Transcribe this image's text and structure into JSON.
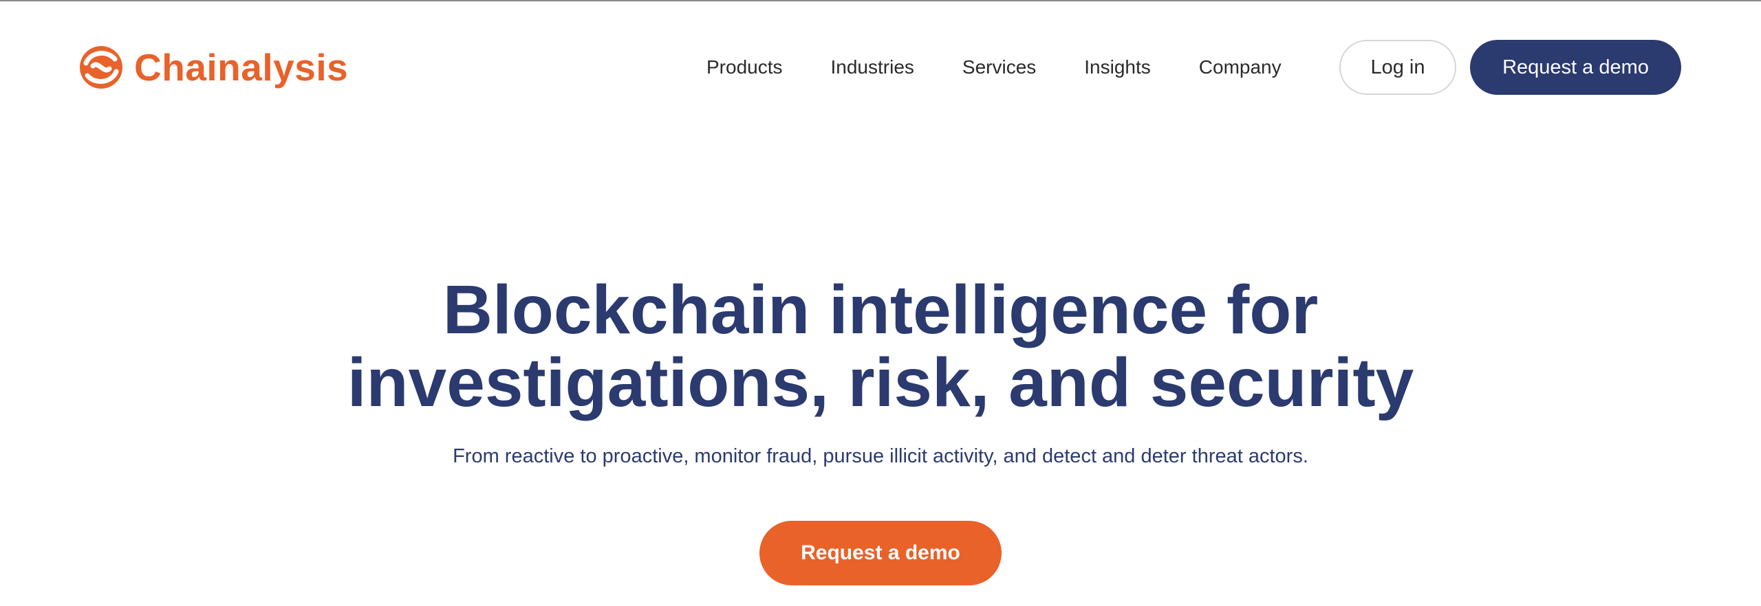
{
  "brand": {
    "name": "Chainalysis",
    "logo_icon": "chainalysis-logo-icon",
    "color": "#e8622a"
  },
  "nav": {
    "items": [
      {
        "label": "Products"
      },
      {
        "label": "Industries"
      },
      {
        "label": "Services"
      },
      {
        "label": "Insights"
      },
      {
        "label": "Company"
      }
    ],
    "login_label": "Log in",
    "demo_label": "Request a demo"
  },
  "hero": {
    "title_line1": "Blockchain intelligence for",
    "title_line2": "investigations, risk, and security",
    "subtitle": "From reactive to proactive, monitor fraud, pursue illicit activity, and detect and deter threat actors.",
    "cta_label": "Request a demo"
  },
  "colors": {
    "primary_navy": "#2b3a6f",
    "accent_orange": "#e8622a"
  }
}
